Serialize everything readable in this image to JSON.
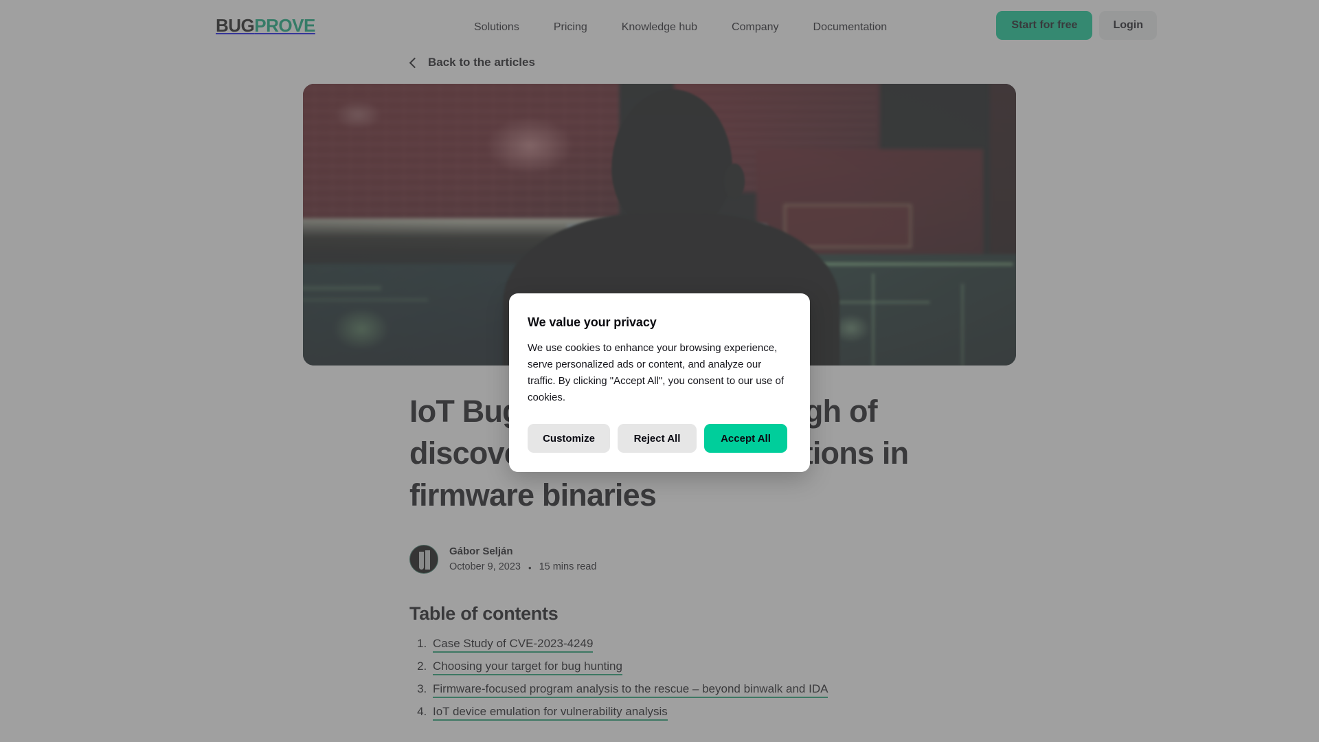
{
  "header": {
    "logo": {
      "dark_part": "BUG",
      "accent_part": "PROVE"
    },
    "nav": [
      {
        "label": "Solutions"
      },
      {
        "label": "Pricing"
      },
      {
        "label": "Knowledge hub"
      },
      {
        "label": "Company"
      },
      {
        "label": "Documentation"
      }
    ],
    "cta_primary": "Start for free",
    "cta_secondary": "Login",
    "accent_color": "#00c98f"
  },
  "back_link": {
    "label": "Back to the articles"
  },
  "article": {
    "title": "IoT Bug Hunting: Walkthrough of discovering command injections in firmware binaries",
    "author": "Gábor Selján",
    "date": "October 9, 2023",
    "separator": "•",
    "read_time": "15 mins read",
    "toc_heading": "Table of contents",
    "toc": [
      {
        "label": "Case Study of CVE-2023-4249"
      },
      {
        "label": "Choosing your target for bug hunting"
      },
      {
        "label": "Firmware-focused program analysis to the rescue – beyond binwalk and IDA"
      },
      {
        "label": "IoT device emulation for vulnerability analysis"
      }
    ],
    "toc_underline_color": "#15a06f"
  },
  "cookie_dialog": {
    "title": "We value your privacy",
    "body": "We use cookies to enhance your browsing experience, serve personalized ads or content, and analyze our traffic. By clicking \"Accept All\", you consent to our use of cookies.",
    "customize_label": "Customize",
    "reject_label": "Reject All",
    "accept_label": "Accept All",
    "accept_color": "#00ce9b"
  }
}
